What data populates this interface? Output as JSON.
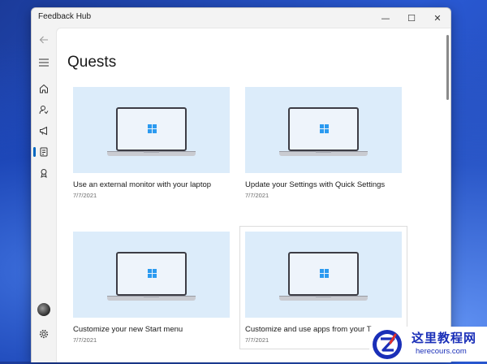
{
  "window": {
    "title": "Feedback Hub",
    "controls": {
      "minimize": "—",
      "maximize": "☐",
      "close": "✕"
    }
  },
  "nav": {
    "items": [
      {
        "icon": "back-arrow-icon"
      },
      {
        "icon": "hamburger-menu-icon"
      },
      {
        "icon": "home-icon"
      },
      {
        "icon": "feedback-icon"
      },
      {
        "icon": "announcements-icon"
      },
      {
        "icon": "quests-icon",
        "selected": true
      },
      {
        "icon": "achievements-icon"
      },
      {
        "icon": "avatar"
      },
      {
        "icon": "gear-icon"
      }
    ]
  },
  "page": {
    "title": "Quests"
  },
  "quests": [
    {
      "title": "Use an external monitor with your laptop",
      "date": "7/7/2021"
    },
    {
      "title": "Update your Settings with Quick Settings",
      "date": "7/7/2021"
    },
    {
      "title": "Customize your new Start menu",
      "date": "7/7/2021"
    },
    {
      "title": "Customize and use apps from your Ta",
      "date": "7/7/2021"
    }
  ],
  "watermark": {
    "name": "这里教程网",
    "url": "herecours.com"
  },
  "colors": {
    "accent": "#0067c0",
    "card_bg": "#dcecfa",
    "logo": "#2b9af0"
  }
}
